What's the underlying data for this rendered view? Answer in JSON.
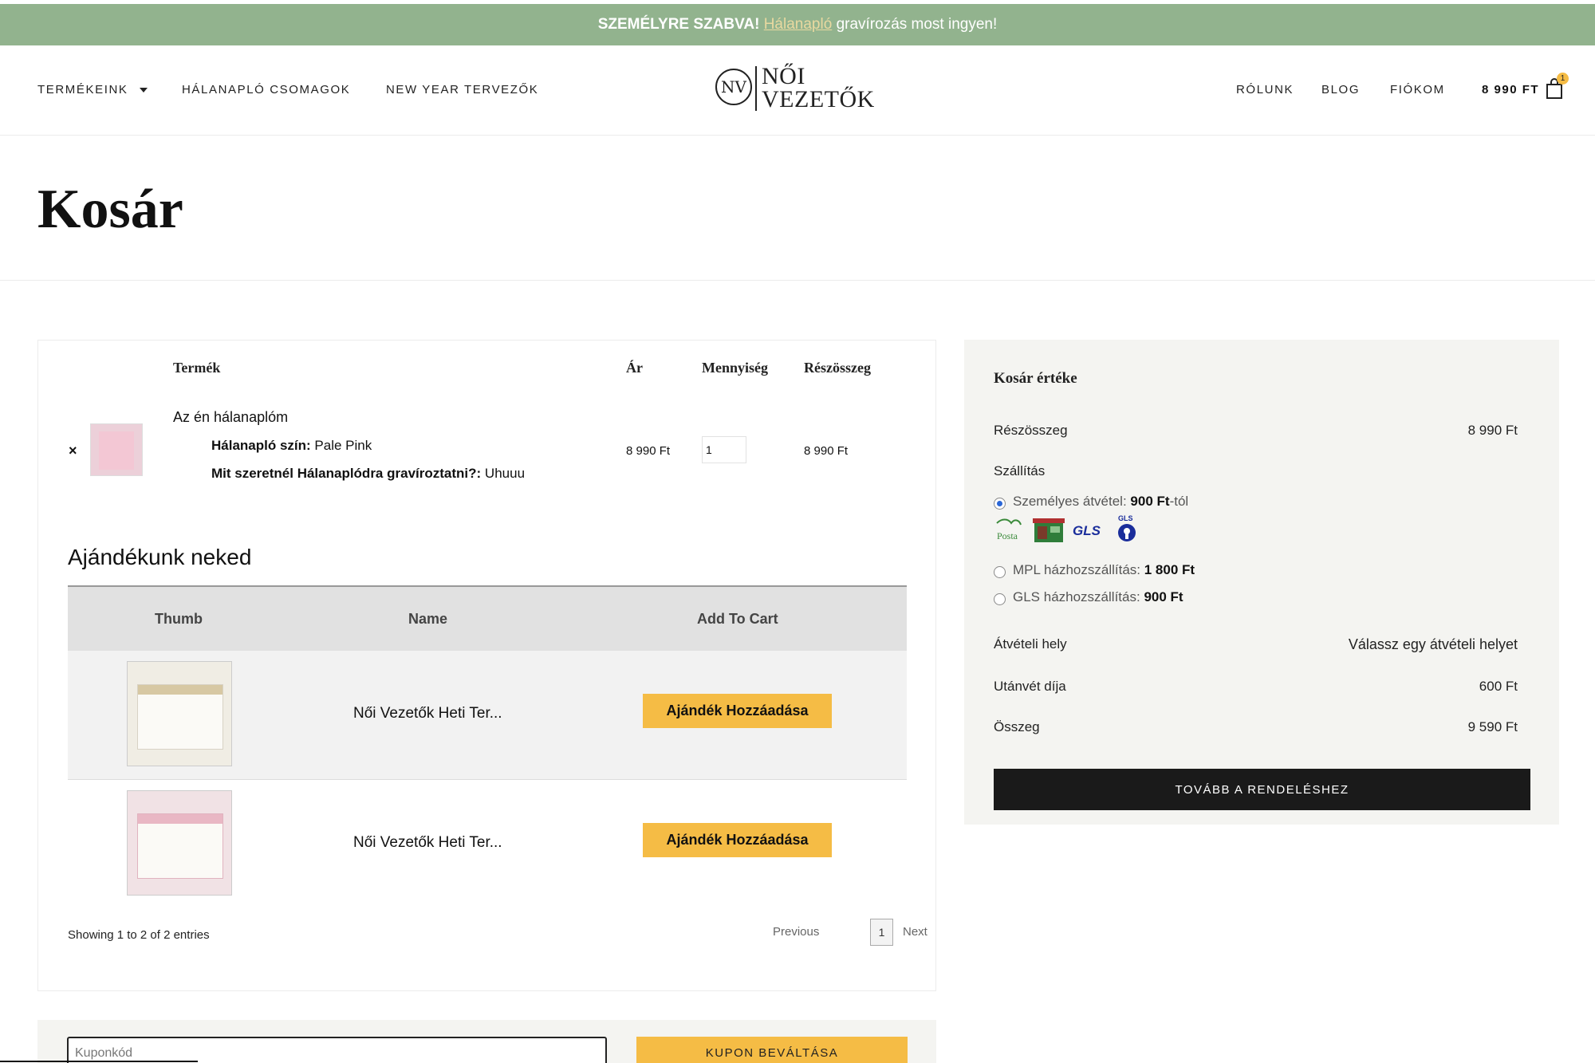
{
  "promo": {
    "strong": "SZEMÉLYRE SZABVA!",
    "link": "Hálanapló",
    "rest": "gravírozás most ingyen!"
  },
  "nav": {
    "products": "TERMÉKEINK",
    "packages": "HÁLANAPLÓ CSOMAGOK",
    "planners": "NEW YEAR TERVEZŐK",
    "about": "RÓLUNK",
    "blog": "BLOG",
    "account": "FIÓKOM"
  },
  "logo": {
    "mark": "NV",
    "line1": "NŐI",
    "line2": "VEZETŐK"
  },
  "header_cart": {
    "total": "8 990 FT",
    "count": "1"
  },
  "page": {
    "title": "Kosár"
  },
  "cart": {
    "headers": {
      "product": "Termék",
      "price": "Ár",
      "quantity": "Mennyiség",
      "subtotal": "Részösszeg"
    },
    "item": {
      "remove": "×",
      "name": "Az én hálanaplóm",
      "meta1_label": "Hálanapló szín:",
      "meta1_value": "Pale Pink",
      "meta2_label": "Mit szeretnél Hálanaplódra gravíroztatni?:",
      "meta2_value": "Uhuuu",
      "price": "8 990 Ft",
      "quantity": "1",
      "subtotal": "8 990 Ft"
    }
  },
  "gifts": {
    "title": "Ajándékunk neked",
    "headers": {
      "thumb": "Thumb",
      "name": "Name",
      "add": "Add To Cart"
    },
    "rows": [
      {
        "name": "Női Vezetők Heti Ter...",
        "button": "Ajándék Hozzáadása"
      },
      {
        "name": "Női Vezetők Heti Ter...",
        "button": "Ajándék Hozzáadása"
      }
    ],
    "showing": "Showing 1 to 2 of 2 entries",
    "pager": {
      "previous": "Previous",
      "page": "1",
      "next": "Next"
    }
  },
  "coupon": {
    "placeholder": "Kuponkód",
    "button": "KUPON BEVÁLTÁSA"
  },
  "totals": {
    "title": "Kosár értéke",
    "subtotal_label": "Részösszeg",
    "subtotal_value": "8 990 Ft",
    "shipping_label": "Szállítás",
    "shipping_options": [
      {
        "label": "Személyes átvétel:",
        "price": "900 Ft",
        "suffix": "-tól",
        "selected": true
      },
      {
        "label": "MPL házhozszállítás:",
        "price": "1 800 Ft",
        "suffix": "",
        "selected": false
      },
      {
        "label": "GLS házhozszállítás:",
        "price": "900 Ft",
        "suffix": "",
        "selected": false
      }
    ],
    "carriers": [
      "Posta",
      "GLS",
      "GLS"
    ],
    "pickup_label": "Átvételi hely",
    "pickup_value": "Válassz egy átvételi helyet",
    "cod_label": "Utánvét díja",
    "cod_value": "600 Ft",
    "total_label": "Összeg",
    "total_value": "9 590 Ft",
    "checkout": "TOVÁBB A RENDELÉSHEZ"
  },
  "colors": {
    "promo_bg": "#92b38e",
    "accent": "#f5bc45",
    "dark": "#1a1a1a",
    "panel_bg": "#f4f4f1"
  }
}
